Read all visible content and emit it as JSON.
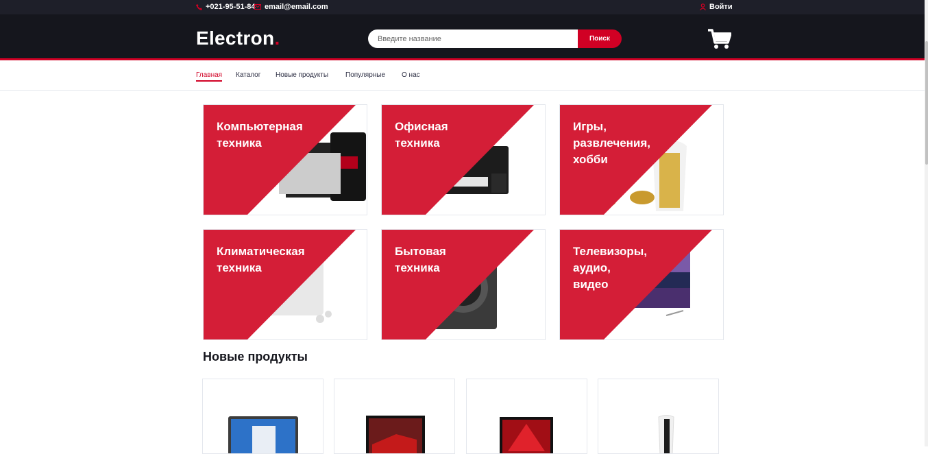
{
  "topbar": {
    "phone": "+021-95-51-84",
    "email": "email@email.com",
    "login": "Войти"
  },
  "header": {
    "logo_text": "Electron",
    "logo_dot": ".",
    "search_placeholder": "Введите название",
    "search_button": "Поиск"
  },
  "nav": {
    "items": [
      "Главная",
      "Каталог",
      "Новые продукты",
      "Популярные",
      "О нас"
    ]
  },
  "categories": [
    "Компьютерная\nтехника",
    "Офисная\nтехника",
    "Игры,\nразвлечения,\nхобби",
    "Климатическая\nтехника",
    "Бытовая\nтехника",
    "Телевизоры,\nаудио,\nвидео"
  ],
  "section_title": "Новые продукты",
  "colors": {
    "accent": "#d10024",
    "dark": "#15161d",
    "topbar": "#1e1f29"
  },
  "icons": [
    "phone-icon",
    "email-icon",
    "user-icon",
    "cart-icon"
  ]
}
